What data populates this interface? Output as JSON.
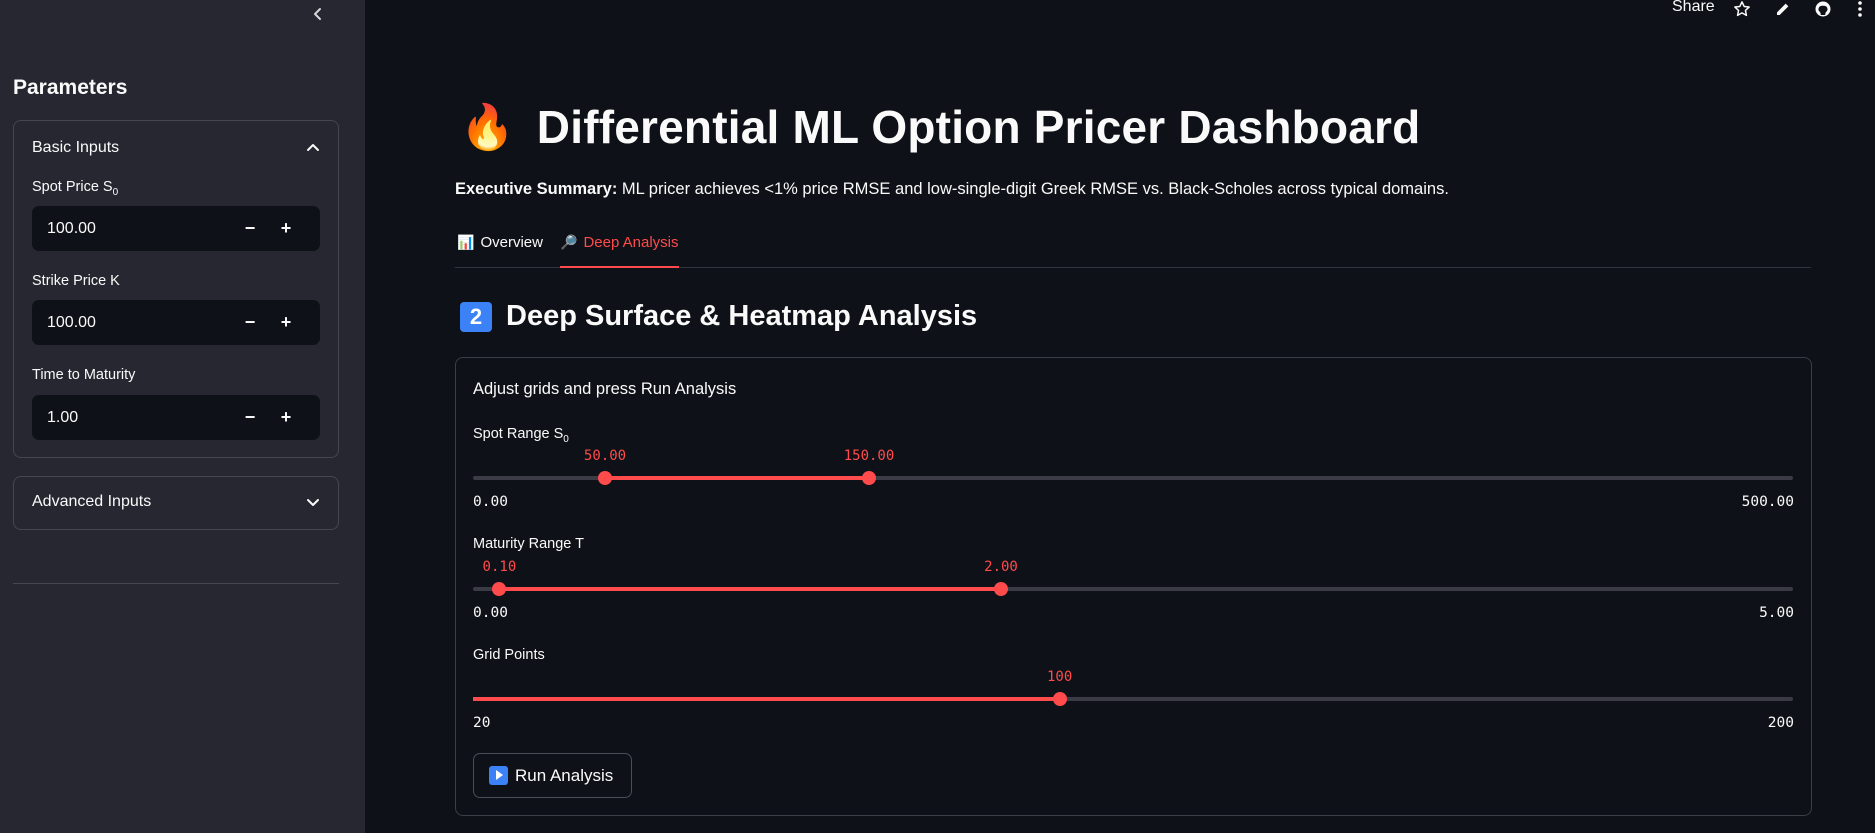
{
  "sidebar": {
    "title": "Parameters",
    "basic_inputs": {
      "label": "Basic Inputs",
      "spot_label": "Spot Price S",
      "spot_sub": "0",
      "spot_value": "100.00",
      "strike_label": "Strike Price K",
      "strike_value": "100.00",
      "maturity_label": "Time to Maturity",
      "maturity_value": "1.00"
    },
    "advanced_inputs": {
      "label": "Advanced Inputs"
    },
    "minus": "−",
    "plus": "+"
  },
  "topbar": {
    "share_label": "Share"
  },
  "main": {
    "title_icon": "🔥",
    "title": "Differential ML Option Pricer Dashboard",
    "summary_bold": "Executive Summary:",
    "summary_text": " ML pricer achieves <1% price RMSE and low-single-digit Greek RMSE vs. Black-Scholes across typical domains.",
    "tabs": [
      {
        "icon": "📊",
        "label": "Overview",
        "active": false
      },
      {
        "icon": "🔎",
        "label": "Deep Analysis",
        "active": true
      }
    ],
    "section_badge": "2",
    "section_title": "Deep Surface & Heatmap Analysis",
    "form": {
      "caption": "Adjust grids and press Run Analysis",
      "spot_range": {
        "label": "Spot Range S",
        "sub": "0",
        "low": 50.0,
        "high": 150.0,
        "low_text": "50.00",
        "high_text": "150.00",
        "min": 0,
        "max": 500,
        "min_text": "0.00",
        "max_text": "500.00"
      },
      "maturity_range": {
        "label": "Maturity Range T",
        "low": 0.1,
        "high": 2.0,
        "low_text": "0.10",
        "high_text": "2.00",
        "min": 0,
        "max": 5,
        "min_text": "0.00",
        "max_text": "5.00"
      },
      "grid_points": {
        "label": "Grid Points",
        "value": 100,
        "value_text": "100",
        "min": 20,
        "max": 200,
        "min_text": "20",
        "max_text": "200"
      },
      "run_label": "Run Analysis"
    }
  },
  "colors": {
    "accent": "#ff4b4b",
    "sidebar_bg": "#262730",
    "main_bg": "#0e1117",
    "badge_blue": "#3b82f6"
  }
}
